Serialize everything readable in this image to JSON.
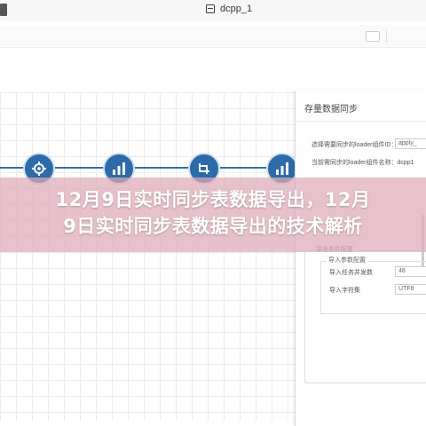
{
  "window": {
    "tab_title": "dcpp_1",
    "doc_icon": "document-icon"
  },
  "panel": {
    "title": "存量数据同步",
    "fields": [
      {
        "label": "选择需要同步的loader组件ID：",
        "value": "apply_"
      },
      {
        "label": "当前需同步的loader组件名称：dcpp1",
        "value": ""
      }
    ],
    "section_legend": "导出条件配置",
    "sub_legend": "导入参数配置",
    "concurrency_label": "导入任务并发数",
    "concurrency_value": "48",
    "charset_label": "导入字符集",
    "charset_value": "UTF8"
  },
  "banner": {
    "line1": "12月9日实时同步表数据导出，12月",
    "line2": "9日实时同步表数据导出的技术解析"
  },
  "flow": {
    "nodes": [
      "settings-gear-icon",
      "bar-chart-icon",
      "transform-icon",
      "bar-chart-icon"
    ],
    "accent": "#2c6ba8"
  }
}
